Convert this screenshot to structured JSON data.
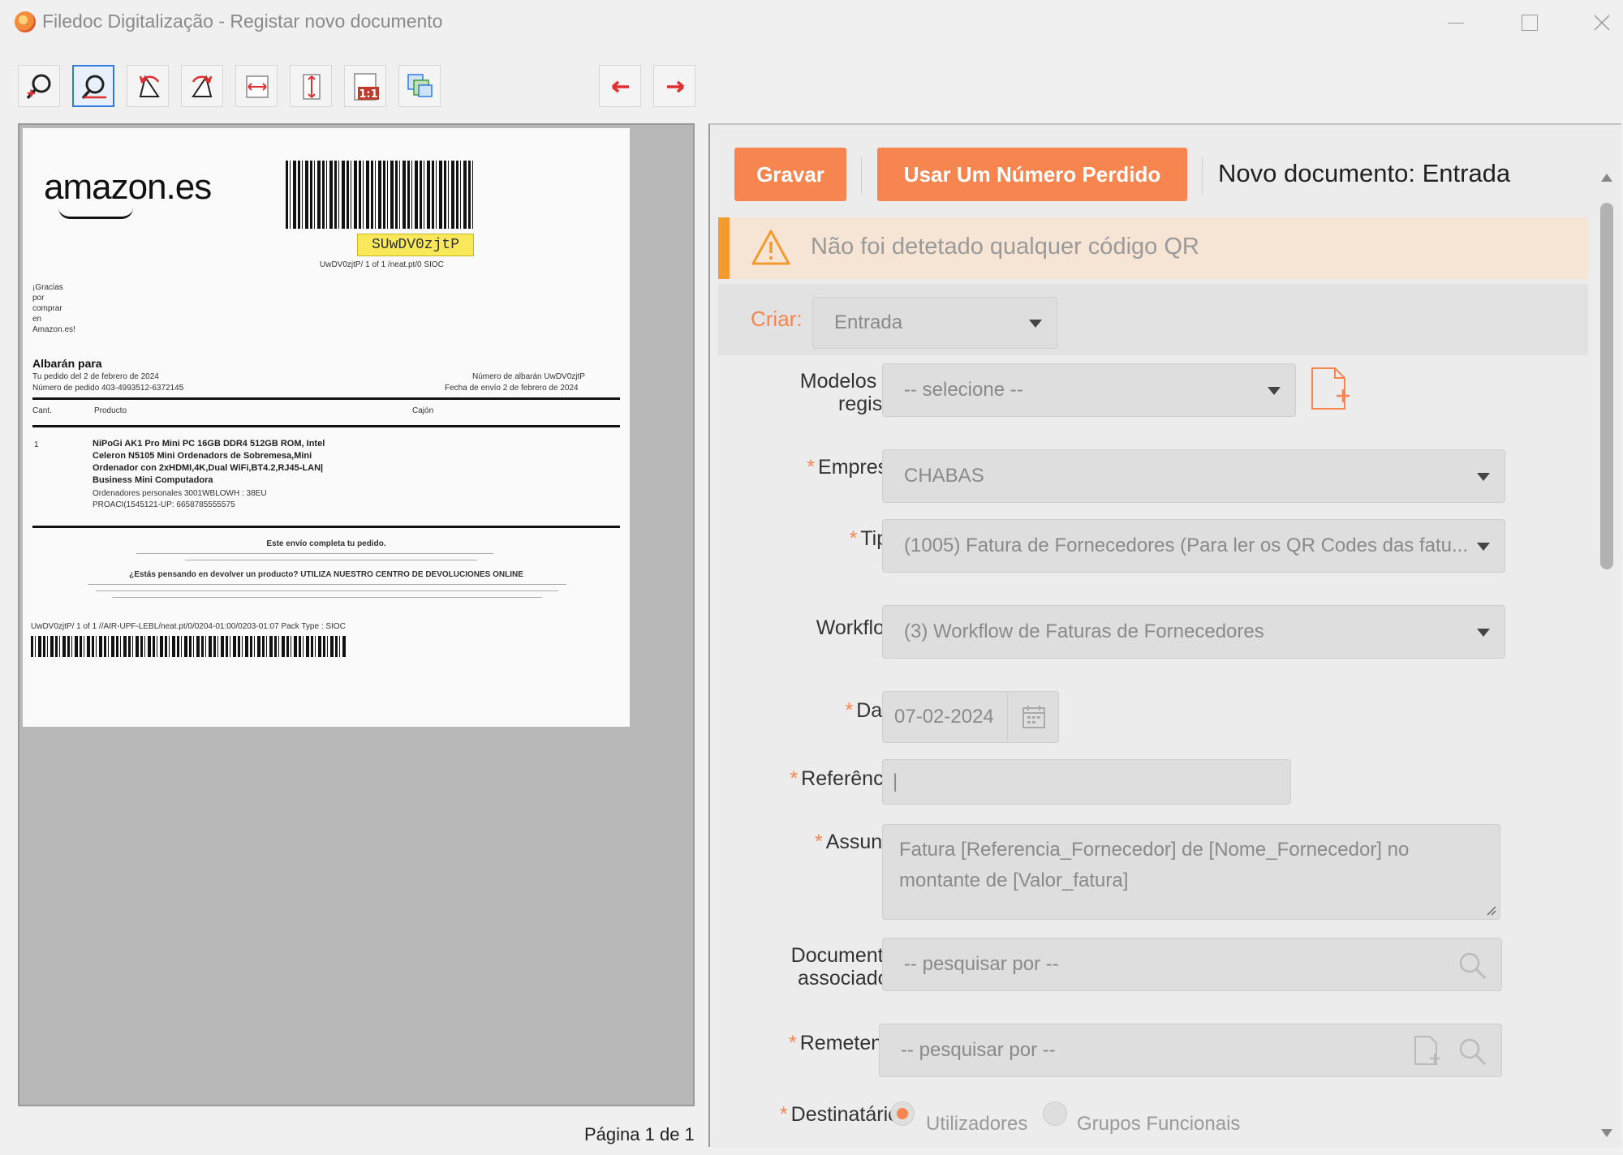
{
  "window": {
    "title": "Filedoc Digitalização - Registar novo documento"
  },
  "toolbar": {
    "buttons": [
      {
        "name": "zoom-in-icon"
      },
      {
        "name": "zoom-out-icon"
      },
      {
        "name": "rotate-left-icon"
      },
      {
        "name": "rotate-right-icon"
      },
      {
        "name": "fit-width-icon"
      },
      {
        "name": "fit-height-icon"
      },
      {
        "name": "actual-size-icon",
        "label": "1:1"
      },
      {
        "name": "multi-page-icon"
      }
    ],
    "prev_page": "prev-page-arrow-icon",
    "next_page": "next-page-arrow-icon"
  },
  "preview": {
    "logo": "amazon.es",
    "highlight_code": "SUwDV0zjtP",
    "code_caption": "UwDV0zjtP/ 1 of 1 /neat.pt/0 SIOC",
    "thanks": "¡Gracias por comprar en Amazon.es!",
    "thanks_lines": [
      "¡Gracias",
      "por",
      "comprar",
      "en",
      "Amazon.es!"
    ],
    "albaran_title": "Albarán para",
    "order_line1": "Tu pedido del 2 de febrero de 2024",
    "order_line2": "Número de pedido 403-4993512-6372145",
    "albaran_num": "Número de albarán UwDV0zjtP",
    "ship_date": "Fecha de envío 2 de febrero de 2024",
    "col_qty": "Cant.",
    "col_product": "Producto",
    "col_location": "Cajón",
    "qty": "1",
    "product_lines": [
      "NiPoGi AK1 Pro Mini PC 16GB DDR4 512GB ROM, Intel",
      "Celeron N5105 Mini Ordenadors de Sobremesa,Mini",
      "Ordenador con 2xHDMI,4K,Dual WiFi,BT4.2,RJ45-LAN|",
      "Business Mini Computadora"
    ],
    "product_sub1": "Ordenadores personales 3001WBLOWH : 38EU",
    "product_sub2": "PROACI(1545121-UP: 6658785555575",
    "complete": "Este envío completa tu pedido.",
    "return_q": "¿Estás pensando en devolver un producto? UTILIZA NUESTRO CENTRO DE DEVOLUCIONES ONLINE",
    "footer_code": "UwDV0zjtP/ 1 of 1 //AIR-UPF-LEBL/neat.pt/0/0204-01:00/0203-01:07 Pack Type : SIOC"
  },
  "pagination": {
    "label": "Página 1 de 1"
  },
  "form": {
    "save_label": "Gravar",
    "lost_number_label": "Usar Um Número Perdido",
    "header": "Novo documento: Entrada",
    "warning": "Não foi detetado qualquer código QR",
    "criar_label": "Criar:",
    "criar_value": "Entrada",
    "modelos_label_1": "Modelos de",
    "modelos_label_2": "registo:",
    "modelos_value": "-- selecione --",
    "empresa_label": "Empresa:",
    "empresa_value": "CHABAS",
    "tipo_label": "Tipo:",
    "tipo_value": "(1005) Fatura de Fornecedores (Para ler os QR Codes das fatu...",
    "workflow_label": "Workflow:",
    "workflow_value": "(3) Workflow de Faturas de Fornecedores",
    "data_label": "Data:",
    "data_value": "07-02-2024",
    "referencia_label": "Referência:",
    "referencia_value": "|",
    "assunto_label": "Assunto:",
    "assunto_value_1": "Fatura [Referencia_Fornecedor] de [Nome_Fornecedor] no",
    "assunto_value_2": "montante de [Valor_fatura]",
    "docs_label_1": "Documentos",
    "docs_label_2": "associados:",
    "docs_placeholder": "-- pesquisar por --",
    "remetente_label": "Remetente:",
    "remetente_placeholder": "-- pesquisar por --",
    "destinatario_label": "Destinatário:",
    "radio_users": "Utilizadores",
    "radio_groups": "Grupos Funcionais"
  },
  "colors": {
    "accent": "#f68550",
    "warning_bar": "#f39b2e",
    "warning_bg": "#f6e5d5",
    "active_tool": "#2c7be5"
  }
}
